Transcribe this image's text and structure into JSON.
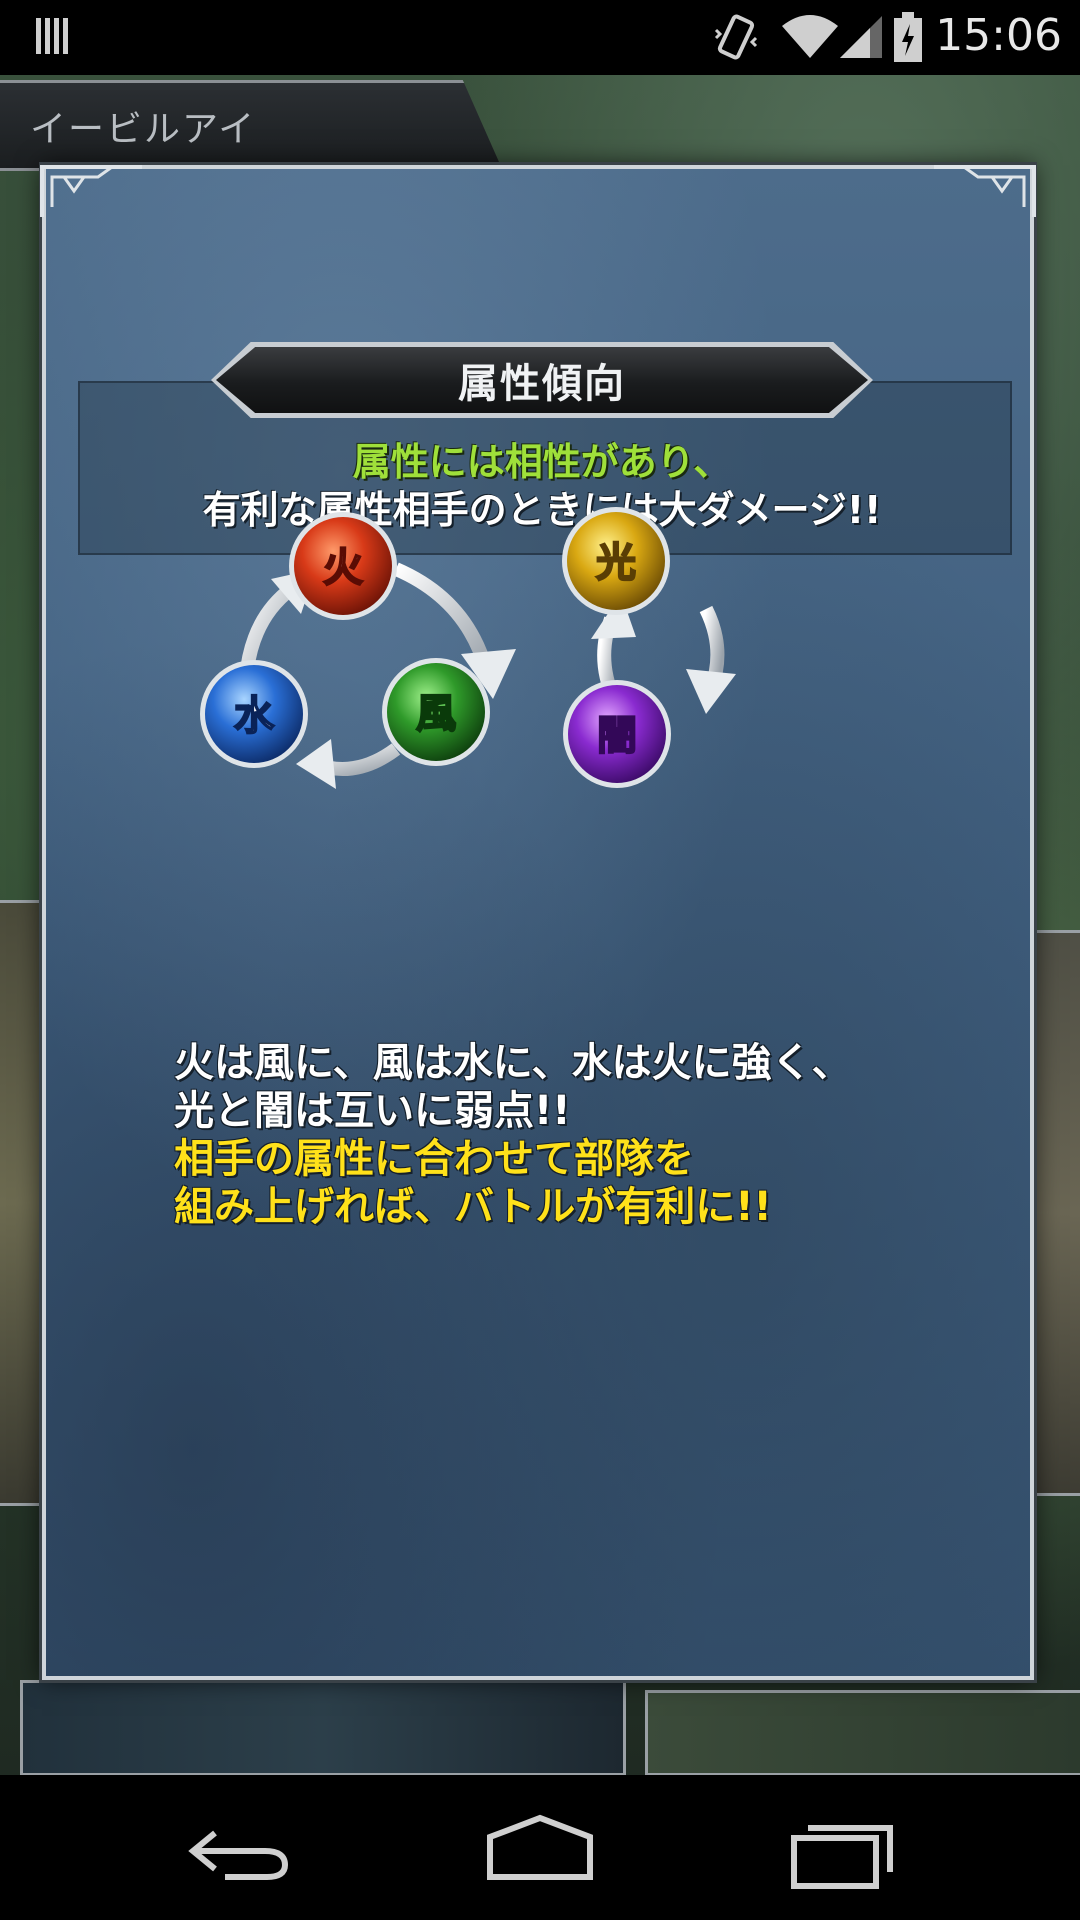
{
  "status_bar": {
    "time": "15:06"
  },
  "background": {
    "tab_label": "イービルアイ"
  },
  "dialog": {
    "title": "属性傾向",
    "info_line1": "属性には相性があり、",
    "info_line2": "有利な属性相手のときには大ダメージ!!",
    "orbs": {
      "fire": "火",
      "wind": "風",
      "water": "水",
      "light": "光",
      "dark": "闇"
    },
    "description": {
      "line1": "火は風に、風は水に、水は火に強く、",
      "line2": "光と闇は互いに弱点!!",
      "line3": "相手の属性に合わせて部隊を",
      "line4": "組み上げれば、バトルが有利に!!"
    },
    "colors": {
      "fire": "#d83a18",
      "wind": "#2f9a2a",
      "water": "#2a6fd6",
      "light": "#d9a812",
      "dark": "#8a2bd0",
      "green_text": "#9fe03a",
      "yellow_text": "#ffe11a"
    }
  },
  "nav_bar": {
    "back": "back-icon",
    "home": "home-icon",
    "recents": "recents-icon"
  }
}
